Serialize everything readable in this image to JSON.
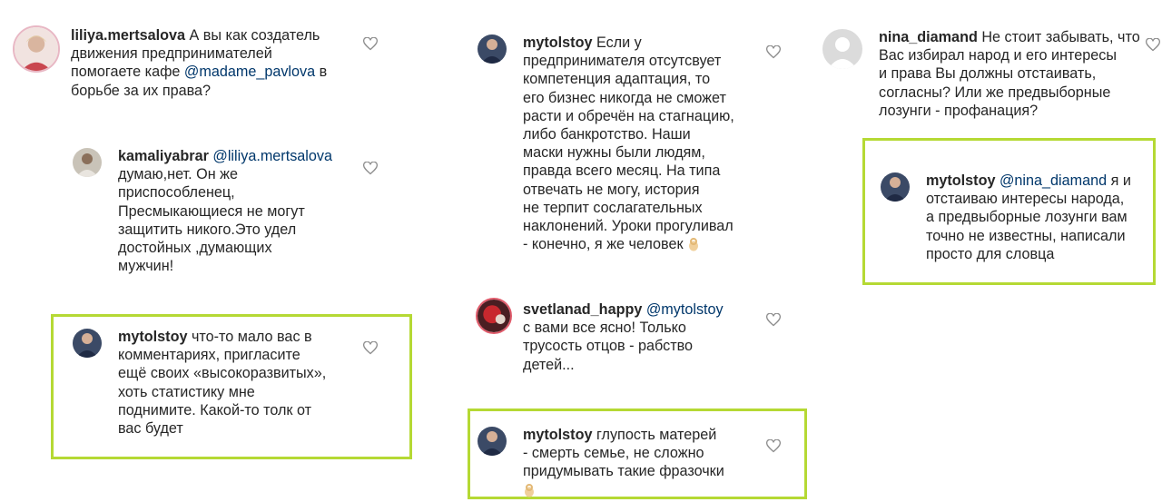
{
  "comments": [
    {
      "id": "c1",
      "username": "liliya.mertsalova",
      "mention": "",
      "text": "А вы как создатель\nдвижения предпринимателей\nпомогаете кафе ",
      "mention_inline": "@madame_pavlova",
      "text_after": " в\nборьбе за их права?"
    },
    {
      "id": "c2",
      "username": "kamaliyabrar",
      "mention": "@liliya.mertsalova",
      "text": "думаю,нет. Он же\nприспособленец,\nПресмыкающиеся не могут\nзащитить никого.Это удел\nдостойных ,думающих\nмужчин!"
    },
    {
      "id": "c3",
      "username": "mytolstoy",
      "mention": "",
      "text": "что-то мало вас в\nкомментариях, пригласите\nещё своих «высокоразвитых»,\nхоть статистику мне\nподнимите. Какой-то толк от\nвас будет"
    },
    {
      "id": "c4",
      "username": "mytolstoy",
      "mention": "",
      "text": "Если у\nпредпринимателя отсутсвует\nкомпетенция адаптация, то\nего бизнес никогда не сможет\nрасти и обречён на стагнацию,\nлибо банкротство. Наши\nмаски нужны были людям,\nправда всего месяц. На типа\nотвечать не могу, история\nне терпит сослагательных\nнаклонений. Уроки прогуливал\n- конечно, я же человек"
    },
    {
      "id": "c5",
      "username": "svetlanad_happy",
      "mention": "@mytolstoy",
      "text": "с вами все ясно! Только\nтрусость отцов - рабство\nдетей..."
    },
    {
      "id": "c6",
      "username": "mytolstoy",
      "mention": "",
      "text": "глупость матерей\n- смерть семье, не сложно\nпридумывать такие фразочки"
    },
    {
      "id": "c7",
      "username": "nina_diamand",
      "mention": "",
      "text": "Не стоит забывать, что\nВас избирал народ и его интересы\nи права Вы должны отстаивать,\nсогласны? Или же предвыборные\nлозунги - профанация?"
    },
    {
      "id": "c8",
      "username": "mytolstoy",
      "mention": "@nina_diamand",
      "text": " я и\nотстаиваю интересы народа,\nа предвыборные лозунги вам\nточно не известны, написали\nпросто для словца"
    }
  ],
  "icons": {
    "like": "heart-outline-icon",
    "emoji": "ok-hand-emoji-icon"
  },
  "colors": {
    "highlight": "#b5d934",
    "mention": "#00376b",
    "text": "#262626",
    "heart": "#8e8e8e"
  }
}
